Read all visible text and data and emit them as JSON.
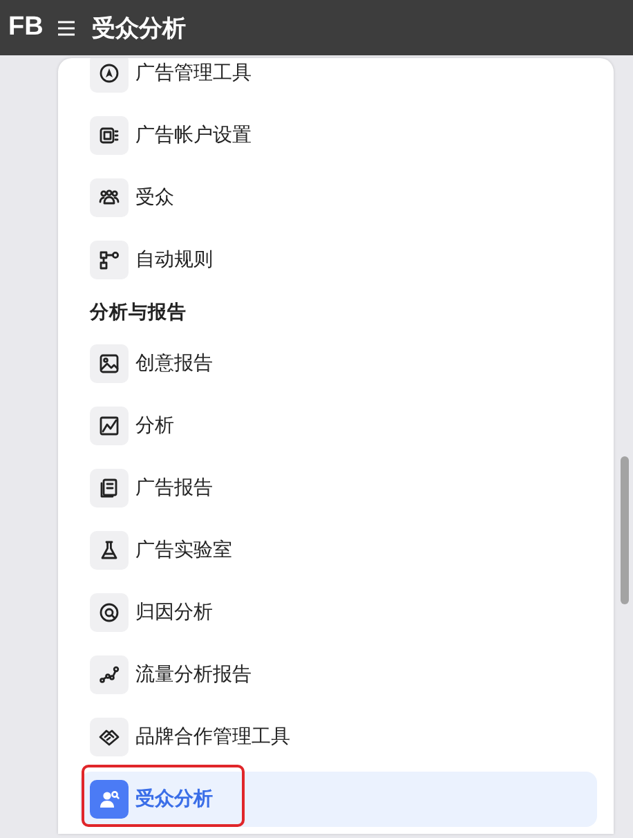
{
  "top_bar": {
    "logo": "FB",
    "title": "受众分析"
  },
  "menu": {
    "items": [
      {
        "kind": "item",
        "label": "广告管理工具",
        "selected": false,
        "outlined": false
      },
      {
        "kind": "item",
        "label": "广告帐户设置",
        "selected": false,
        "outlined": false
      },
      {
        "kind": "item",
        "label": "受众",
        "selected": false,
        "outlined": false
      },
      {
        "kind": "item",
        "label": "自动规则",
        "selected": false,
        "outlined": false
      },
      {
        "kind": "header",
        "label": "分析与报告"
      },
      {
        "kind": "item",
        "label": "创意报告",
        "selected": false,
        "outlined": false
      },
      {
        "kind": "item",
        "label": "分析",
        "selected": false,
        "outlined": false
      },
      {
        "kind": "item",
        "label": "广告报告",
        "selected": false,
        "outlined": false
      },
      {
        "kind": "item",
        "label": "广告实验室",
        "selected": false,
        "outlined": false
      },
      {
        "kind": "item",
        "label": "归因分析",
        "selected": false,
        "outlined": false
      },
      {
        "kind": "item",
        "label": "流量分析报告",
        "selected": false,
        "outlined": false
      },
      {
        "kind": "item",
        "label": "品牌合作管理工具",
        "selected": false,
        "outlined": false
      },
      {
        "kind": "item",
        "label": "受众分析",
        "selected": true,
        "outlined": true
      }
    ]
  }
}
